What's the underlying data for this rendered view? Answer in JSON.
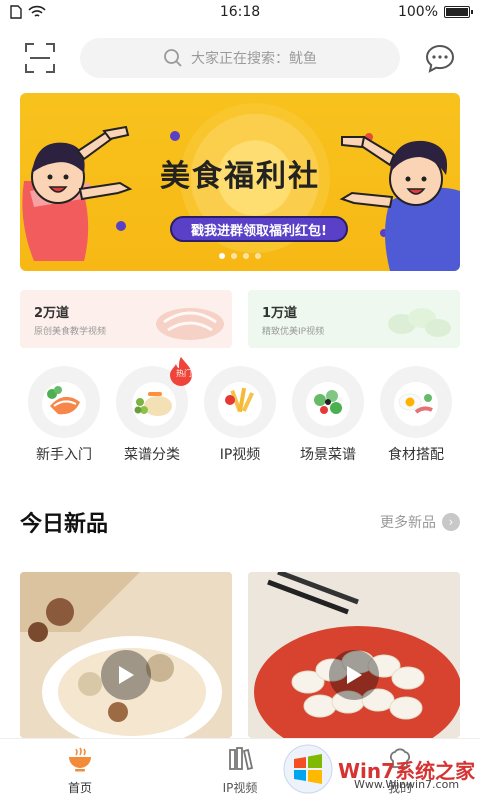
{
  "status_bar": {
    "time": "16:18",
    "battery": "100%",
    "battery_level": 1.0
  },
  "search": {
    "placeholder": "大家正在搜索：鱿鱼"
  },
  "banner": {
    "title": "美食福利社",
    "button_label": "戳我进群领取福利红包!",
    "slide_count": 4,
    "active_slide": 0
  },
  "promo_cards": [
    {
      "count": "2万道",
      "desc": "原创美食教学视频"
    },
    {
      "count": "1万道",
      "desc": "精致优美IP视频"
    }
  ],
  "categories": [
    {
      "label": "新手入门",
      "icon": "salmon-dish-icon"
    },
    {
      "label": "菜谱分类",
      "icon": "vegetable-rice-icon",
      "badge": "热门"
    },
    {
      "label": "IP视频",
      "icon": "fries-icon"
    },
    {
      "label": "场景菜谱",
      "icon": "salad-icon"
    },
    {
      "label": "食材搭配",
      "icon": "bacon-egg-icon"
    }
  ],
  "section": {
    "title": "今日新品",
    "more": "更多新品"
  },
  "products": [
    {
      "name": "soup-video",
      "icon": "play-icon"
    },
    {
      "name": "rice-cake-video",
      "icon": "play-icon"
    }
  ],
  "tabs": [
    {
      "label": "首页",
      "icon": "bowl-icon",
      "active": true
    },
    {
      "label": "IP视频",
      "icon": "books-icon",
      "active": false
    },
    {
      "label": "我的",
      "icon": "chef-hat-icon",
      "active": false
    }
  ],
  "watermark": {
    "brand": "Win7系统之家",
    "url": "Www.Winwin7.com"
  },
  "colors": {
    "accent": "#f28b3a",
    "banner_bg": "#f8c21d",
    "banner_button": "#5a3fc7",
    "hot_badge": "#f0443a"
  }
}
